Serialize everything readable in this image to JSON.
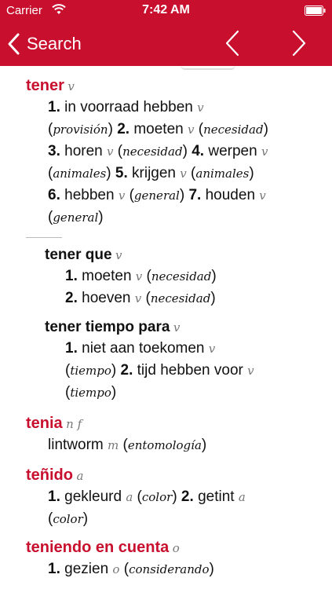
{
  "status": {
    "carrier": "Carrier",
    "time": "7:42 AM"
  },
  "nav": {
    "back_label": "Search"
  },
  "entries": {
    "tener": {
      "headword": "tener",
      "pos": "v",
      "s1_num": "1.",
      "s1_text": "in voorraad hebben",
      "s1_pos": "v",
      "s1_gloss": "provisión",
      "s2_num": "2.",
      "s2_text": "moeten",
      "s2_pos": "v",
      "s2_gloss": "necesidad",
      "s3_num": "3.",
      "s3_text": "horen",
      "s3_pos": "v",
      "s3_gloss": "necesidad",
      "s4_num": "4.",
      "s4_text": "werpen",
      "s4_pos": "v",
      "s4_gloss": "animales",
      "s5_num": "5.",
      "s5_text": "krijgen",
      "s5_pos": "v",
      "s5_gloss": "animales",
      "s6_num": "6.",
      "s6_text": "hebben",
      "s6_pos": "v",
      "s6_gloss": "general",
      "s7_num": "7.",
      "s7_text": "houden",
      "s7_pos": "v",
      "s7_gloss": "general"
    },
    "tener_que": {
      "headword": "tener que",
      "pos": "v",
      "s1_num": "1.",
      "s1_text": "moeten",
      "s1_pos": "v",
      "s1_gloss": "necesidad",
      "s2_num": "2.",
      "s2_text": "hoeven",
      "s2_pos": "v",
      "s2_gloss": "necesidad"
    },
    "tener_tiempo_para": {
      "headword": "tener tiempo para",
      "pos": "v",
      "s1_num": "1.",
      "s1_text": "niet aan toekomen",
      "s1_pos": "v",
      "s1_gloss": "tiempo",
      "s2_num": "2.",
      "s2_text": "tijd hebben voor",
      "s2_pos": "v",
      "s2_gloss": "tiempo"
    },
    "tenia": {
      "headword": "tenia",
      "pos": "n f",
      "s1_text": "lintworm",
      "s1_pos": "m",
      "s1_gloss": "entomología"
    },
    "tenido": {
      "headword": "teñido",
      "pos": "a",
      "s1_num": "1.",
      "s1_text": "gekleurd",
      "s1_pos": "a",
      "s1_gloss": "color",
      "s2_num": "2.",
      "s2_text": "getint",
      "s2_pos": "a",
      "s2_gloss": "color"
    },
    "teniendo": {
      "headword": "teniendo en cuenta",
      "pos": "o",
      "s1_num": "1.",
      "s1_text": "gezien",
      "s1_pos": "o",
      "s1_gloss": "considerando"
    }
  },
  "colors": {
    "accent": "#c8102e"
  }
}
